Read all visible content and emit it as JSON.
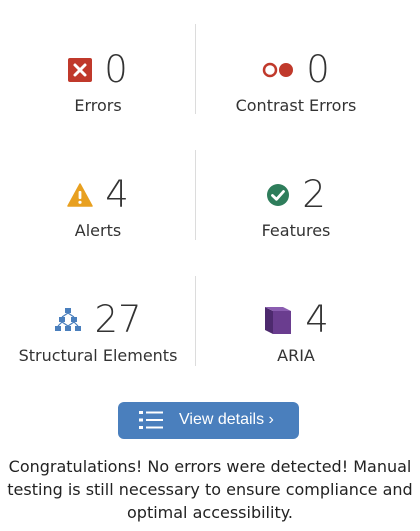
{
  "summary": {
    "errors": {
      "count": "0",
      "label": "Errors",
      "icon": "error-x-icon",
      "color": "#c0392b"
    },
    "contrast": {
      "count": "0",
      "label": "Contrast Errors",
      "icon": "contrast-circles-icon",
      "color": "#c0392b"
    },
    "alerts": {
      "count": "4",
      "label": "Alerts",
      "icon": "alert-triangle-icon",
      "color": "#e8a020"
    },
    "features": {
      "count": "2",
      "label": "Features",
      "icon": "check-circle-icon",
      "color": "#2e7d5b"
    },
    "structural": {
      "count": "27",
      "label": "Structural Elements",
      "icon": "hierarchy-icon",
      "color": "#4a7fbd"
    },
    "aria": {
      "count": "4",
      "label": "ARIA",
      "icon": "aria-box-icon",
      "color": "#6a3d8f"
    }
  },
  "details_button": {
    "label": "View details ›",
    "icon": "list-icon"
  },
  "message": "Congratulations! No errors were detected! Manual testing is still necessary to ensure compliance and optimal accessibility."
}
